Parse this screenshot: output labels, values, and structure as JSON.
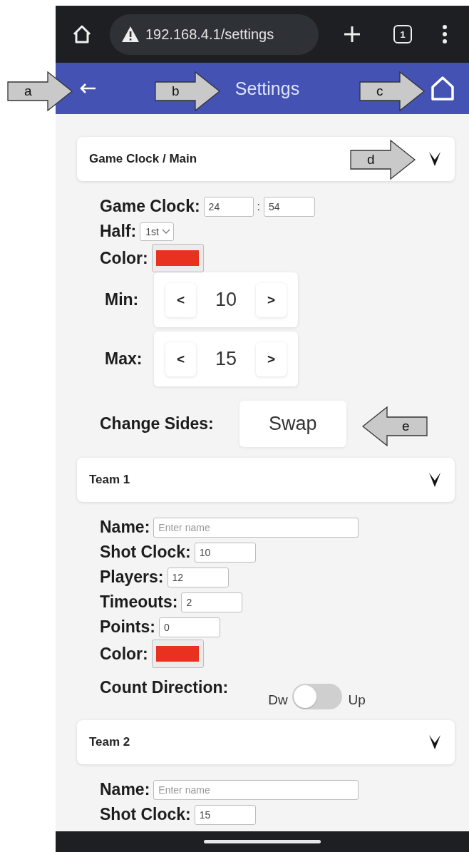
{
  "browser": {
    "url": "192.168.4.1/settings",
    "tab_count": "1"
  },
  "app_bar": {
    "title": "Settings"
  },
  "sections": [
    {
      "title": "Game Clock / Main",
      "fields": [
        {
          "kind": "clock",
          "label": "Game Clock:",
          "minutes": "24",
          "separator": ":",
          "seconds": "54"
        },
        {
          "kind": "select",
          "label": "Half:",
          "value": "1st"
        },
        {
          "kind": "color",
          "label": "Color:",
          "color": "#e8321f"
        },
        {
          "kind": "stepper",
          "label": "Min:",
          "decrement": "<",
          "value": "10",
          "increment": ">"
        },
        {
          "kind": "stepper",
          "label": "Max:",
          "decrement": "<",
          "value": "15",
          "increment": ">"
        },
        {
          "kind": "button",
          "label": "Change Sides:",
          "button": "Swap"
        }
      ]
    },
    {
      "title": "Team 1",
      "fields": [
        {
          "kind": "wide_text",
          "label": "Name:",
          "placeholder": "Enter name"
        },
        {
          "kind": "text",
          "label": "Shot Clock:",
          "value": "10"
        },
        {
          "kind": "text",
          "label": "Players:",
          "value": "12"
        },
        {
          "kind": "text",
          "label": "Timeouts:",
          "value": "2"
        },
        {
          "kind": "text",
          "label": "Points:",
          "value": "0"
        },
        {
          "kind": "color",
          "label": "Color:",
          "color": "#e8321f"
        },
        {
          "kind": "toggle",
          "label": "Count Direction:",
          "off_label": "Dw",
          "on_label": "Up",
          "on": false
        }
      ]
    },
    {
      "title": "Team 2",
      "fields": [
        {
          "kind": "wide_text",
          "label": "Name:",
          "placeholder": "Enter name"
        },
        {
          "kind": "text",
          "label": "Shot Clock:",
          "value": "15"
        }
      ]
    }
  ],
  "callouts": [
    {
      "label": "a",
      "kind": "right"
    },
    {
      "label": "b",
      "kind": "right"
    },
    {
      "label": "c",
      "kind": "right"
    },
    {
      "label": "d",
      "kind": "right"
    },
    {
      "label": "e",
      "kind": "left"
    }
  ]
}
